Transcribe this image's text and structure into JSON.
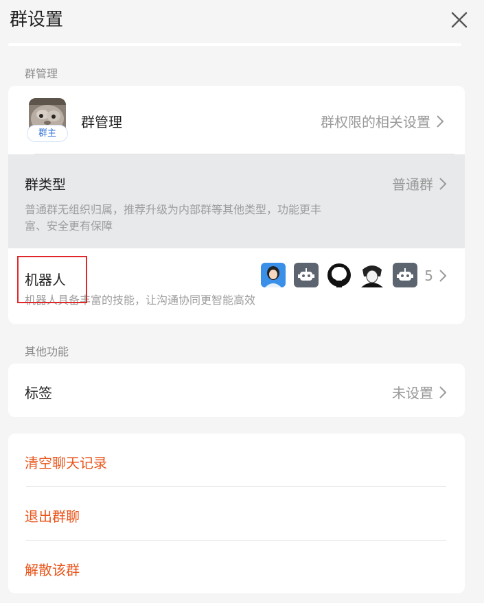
{
  "header": {
    "title": "群设置"
  },
  "group_manage_section": {
    "label": "群管理",
    "manage_row": {
      "title": "群管理",
      "owner_badge": "群主",
      "right_text": "群权限的相关设置"
    },
    "type_row": {
      "title": "群类型",
      "right_text": "普通群",
      "desc_line1": "普通群无组织归属，推荐升级为内部群等其他类型，功能更丰",
      "desc_line2": "富、安全更有保障"
    },
    "robot_row": {
      "title": "机器人",
      "count": "5",
      "desc": "机器人具备丰富的技能，让沟通协同更智能高效",
      "icons": [
        "person-avatar-icon",
        "robot-icon",
        "github-icon",
        "anime-avatar-icon",
        "robot-icon"
      ]
    }
  },
  "other_section": {
    "label": "其他功能",
    "tag_row": {
      "title": "标签",
      "right_text": "未设置"
    }
  },
  "actions": {
    "clear_history": "清空聊天记录",
    "quit_group": "退出群聊",
    "dissolve_group": "解散该群"
  },
  "colors": {
    "danger": "#e8541a",
    "highlight_box": "#e0282a",
    "selected_row_bg": "#e8e9eb"
  }
}
